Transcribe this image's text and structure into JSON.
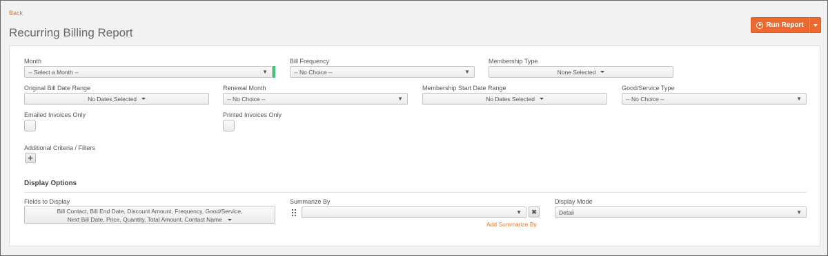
{
  "nav": {
    "back_label": "Back"
  },
  "page": {
    "title": "Recurring Billing Report"
  },
  "toolbar": {
    "run_report_label": "Run Report"
  },
  "filters": {
    "month": {
      "label": "Month",
      "value": "-- Select a Month --"
    },
    "bill_frequency": {
      "label": "Bill Frequency",
      "value": "-- No Choice --"
    },
    "membership_type": {
      "label": "Membership Type",
      "value": "None Selected"
    },
    "original_bill_date_range": {
      "label": "Original Bill Date Range",
      "value": "No Dates Selected"
    },
    "renewal_month": {
      "label": "Renewal Month",
      "value": "-- No Choice --"
    },
    "membership_start_date_range": {
      "label": "Membership Start Date Range",
      "value": "No Dates Selected"
    },
    "good_service_type": {
      "label": "Good/Service Type",
      "value": "-- No Choice --"
    },
    "emailed_invoices_only": {
      "label": "Emailed Invoices Only"
    },
    "printed_invoices_only": {
      "label": "Printed Invoices Only"
    },
    "additional_criteria": {
      "label": "Additional Criteria / Filters"
    }
  },
  "display_options": {
    "heading": "Display Options",
    "fields_to_display": {
      "label": "Fields to Display",
      "line1": "Bill Contact,  Bill End Date,  Discount Amount,  Frequency,  Good/Service,",
      "line2": "Next Bill Date,  Price,  Quantity,  Total Amount,  Contact Name"
    },
    "summarize_by": {
      "label": "Summarize By",
      "value": "",
      "add_label": "Add Summarize By"
    },
    "display_mode": {
      "label": "Display Mode",
      "value": "Detail"
    }
  },
  "icons": {
    "dropdown": "▼",
    "plus": "+",
    "remove": "✖"
  },
  "colors": {
    "accent": "#ec6a2f",
    "link": "#e8712f",
    "valid": "#3cc77a"
  }
}
